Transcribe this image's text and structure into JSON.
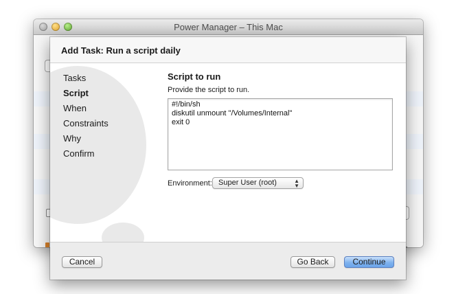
{
  "window": {
    "title": "Power Manager – This Mac"
  },
  "sheet": {
    "title": "Add Task: Run a script daily",
    "steps": [
      {
        "label": "Tasks",
        "active": false
      },
      {
        "label": "Script",
        "active": true
      },
      {
        "label": "When",
        "active": false
      },
      {
        "label": "Constraints",
        "active": false
      },
      {
        "label": "Why",
        "active": false
      },
      {
        "label": "Confirm",
        "active": false
      }
    ],
    "panel": {
      "title": "Script to run",
      "description": "Provide the script to run.",
      "script": "#!/bin/sh\ndiskutil unmount \"/Volumes/Internal\"\nexit 0",
      "environment_label": "Environment:",
      "environment_value": "Super User (root)"
    },
    "buttons": {
      "cancel": "Cancel",
      "back": "Go Back",
      "continue": "Continue"
    }
  },
  "colors": {
    "default_button": "#7fb2ee",
    "sheet_background": "#ededed"
  },
  "icons": {
    "environment_select": "up-down-arrows-icon",
    "traffic_lights": [
      "close-icon",
      "minimize-icon",
      "zoom-icon"
    ]
  }
}
